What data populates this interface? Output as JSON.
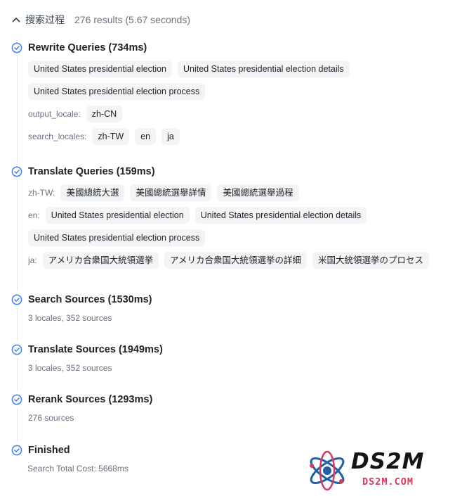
{
  "header": {
    "title": "搜索过程",
    "meta": "276 results  (5.67 seconds)"
  },
  "steps": [
    {
      "title": "Rewrite Queries (734ms)",
      "chips": [
        "United States presidential election",
        "United States presidential election details",
        "United States presidential election process"
      ],
      "output_locale": {
        "label": "output_locale:",
        "values": [
          "zh-CN"
        ]
      },
      "search_locales": {
        "label": "search_locales:",
        "values": [
          "zh-TW",
          "en",
          "ja"
        ]
      }
    },
    {
      "title": "Translate Queries (159ms)",
      "zh_tw": {
        "label": "zh-TW:",
        "values": [
          "美國總統大選",
          "美國總統選舉詳情",
          "美國總統選舉過程"
        ]
      },
      "en": {
        "label": "en:",
        "values": [
          "United States presidential election",
          "United States presidential election details",
          "United States presidential election process"
        ]
      },
      "ja": {
        "label": "ja:",
        "values": [
          "アメリカ合衆国大統領選挙",
          "アメリカ合衆国大統領選挙の詳細",
          "米国大統領選挙のプロセス"
        ]
      }
    },
    {
      "title": "Search Sources (1530ms)",
      "sub": "3 locales, 352 sources"
    },
    {
      "title": "Translate Sources (1949ms)",
      "sub": "3 locales, 352 sources"
    },
    {
      "title": "Rerank Sources (1293ms)",
      "sub": "276 sources"
    },
    {
      "title": "Finished",
      "sub": "Search Total Cost: 5668ms"
    }
  ],
  "watermark": {
    "brand": "DS2M",
    "domain": "DS2M.COM"
  },
  "colors": {
    "accent": "#3b82f6",
    "chip_bg": "#f2f4f6",
    "watermark_red": "#d9385f",
    "watermark_blue": "#1f5fa8"
  },
  "icons": {
    "header_toggle": "chevron-up-icon",
    "step_status": "check-circle-icon",
    "logo_mark": "atom-icon"
  }
}
